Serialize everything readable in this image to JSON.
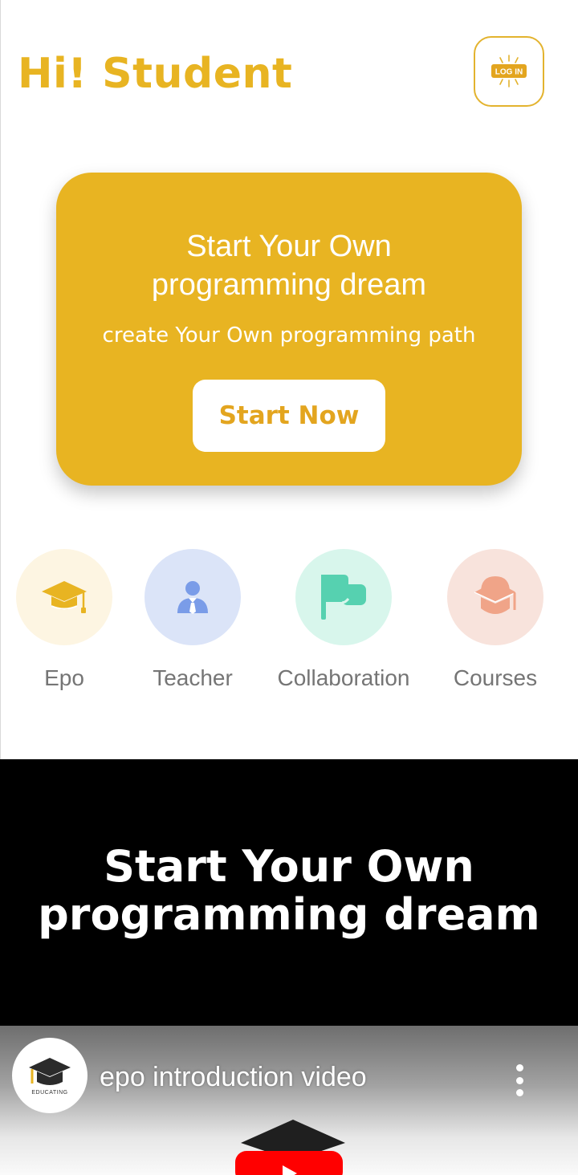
{
  "header": {
    "greeting": "Hi! Student",
    "login_icon_text": "LOG IN",
    "login_icon": "login-badge-icon"
  },
  "hero": {
    "title": "Start Your Own programming dream",
    "subtitle": "create Your Own programming path",
    "button_label": "Start Now"
  },
  "categories": [
    {
      "label": "Epo",
      "icon": "graduation-cap-icon",
      "circle_color": "#fdf5e2",
      "icon_color": "#e8b422"
    },
    {
      "label": "Teacher",
      "icon": "teacher-person-icon",
      "circle_color": "#dbe4f8",
      "icon_color": "#7a9ce8"
    },
    {
      "label": "Collaboration",
      "icon": "chat-flag-icon",
      "circle_color": "#d8f6ec",
      "icon_color": "#56d1b0"
    },
    {
      "label": "Courses",
      "icon": "course-cap-icon",
      "circle_color": "#f8e3dc",
      "icon_color": "#f0a488"
    }
  ],
  "promo": {
    "title": "Start Your Own programming dream"
  },
  "video": {
    "title": "epo introduction video",
    "channel_logo_text": "EDUCATING",
    "menu_icon": "more-vertical-icon",
    "play_icon": "play-button-icon"
  },
  "colors": {
    "accent": "#e8b422",
    "promo_background": "#000000"
  }
}
